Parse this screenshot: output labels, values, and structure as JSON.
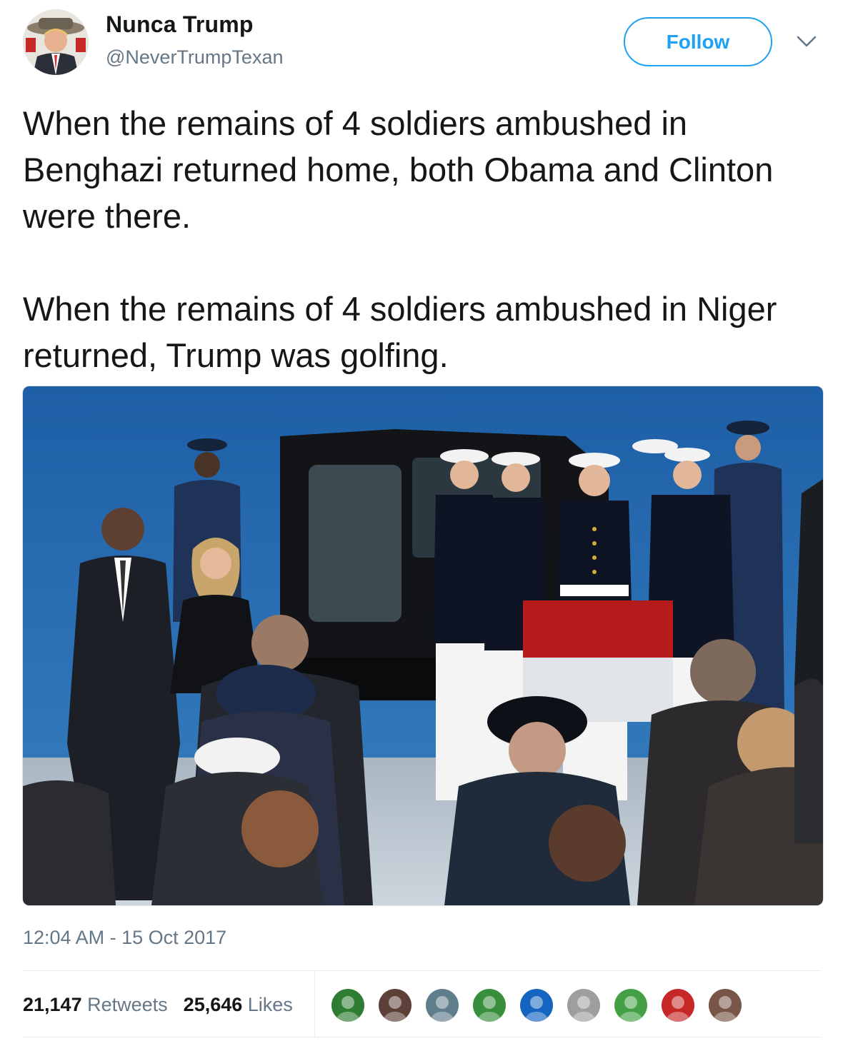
{
  "author": {
    "display_name": "Nunca Trump",
    "handle": "@NeverTrumpTexan"
  },
  "follow_label": "Follow",
  "tweet": {
    "text": "When the remains of 4 soldiers ambushed in Benghazi returned home, both Obama and Clinton were there.\n\nWhen the remains of 4 soldiers ambushed in Niger returned, Trump was golfing.",
    "timestamp": "12:04 AM - 15 Oct 2017"
  },
  "stats": {
    "retweets_count": "21,147",
    "retweets_label": "Retweets",
    "likes_count": "25,646",
    "likes_label": "Likes"
  },
  "colors": {
    "accent": "#1da1f2",
    "secondary_text": "#657786",
    "primary_text": "#14171a",
    "divider": "#e6ecf0"
  },
  "icons": {
    "caret": "chevron-down-icon"
  },
  "liker_avatars": [
    {
      "color": "#2e7d32"
    },
    {
      "color": "#5d4037"
    },
    {
      "color": "#607d8b"
    },
    {
      "color": "#388e3c"
    },
    {
      "color": "#1565c0"
    },
    {
      "color": "#9e9e9e"
    },
    {
      "color": "#43a047"
    },
    {
      "color": "#c62828"
    },
    {
      "color": "#795548"
    }
  ]
}
